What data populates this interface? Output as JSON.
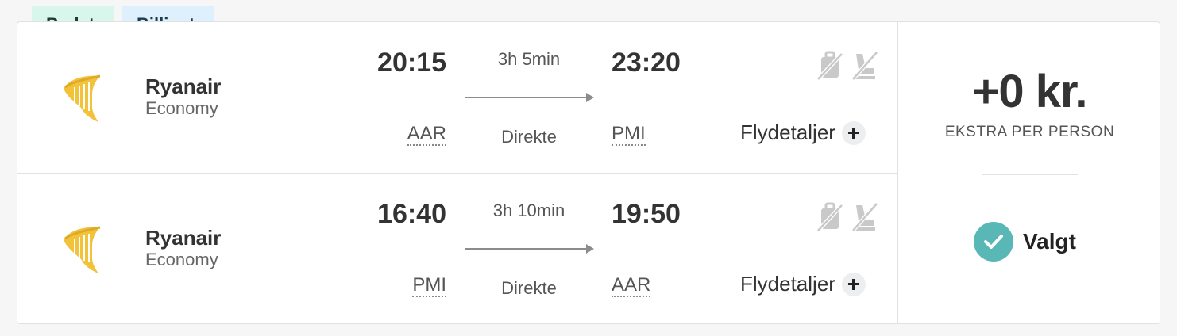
{
  "tags": {
    "best": "Bedst",
    "cheapest": "Billigst"
  },
  "legs": [
    {
      "airline": "Ryanair",
      "cabin": "Economy",
      "departure_time": "20:15",
      "arrival_time": "23:20",
      "duration": "3h 5min",
      "stops": "Direkte",
      "origin": "AAR",
      "destination": "PMI",
      "details_label": "Flydetaljer"
    },
    {
      "airline": "Ryanair",
      "cabin": "Economy",
      "departure_time": "16:40",
      "arrival_time": "19:50",
      "duration": "3h 10min",
      "stops": "Direkte",
      "origin": "PMI",
      "destination": "AAR",
      "details_label": "Flydetaljer"
    }
  ],
  "price": {
    "amount": "+0 kr.",
    "subtitle": "EKSTRA PER PERSON",
    "selected_label": "Valgt"
  },
  "colors": {
    "logo": "#f1c23a",
    "selected": "#59b7b5",
    "tag_best_bg": "#d8f6ec",
    "tag_cheapest_bg": "#ddf0fb"
  },
  "icons": {
    "airline_logo": "ryanair-harp-icon",
    "baggage": "no-baggage-icon",
    "seat": "no-seat-selection-icon",
    "details": "plus-icon",
    "selected": "check-icon"
  }
}
